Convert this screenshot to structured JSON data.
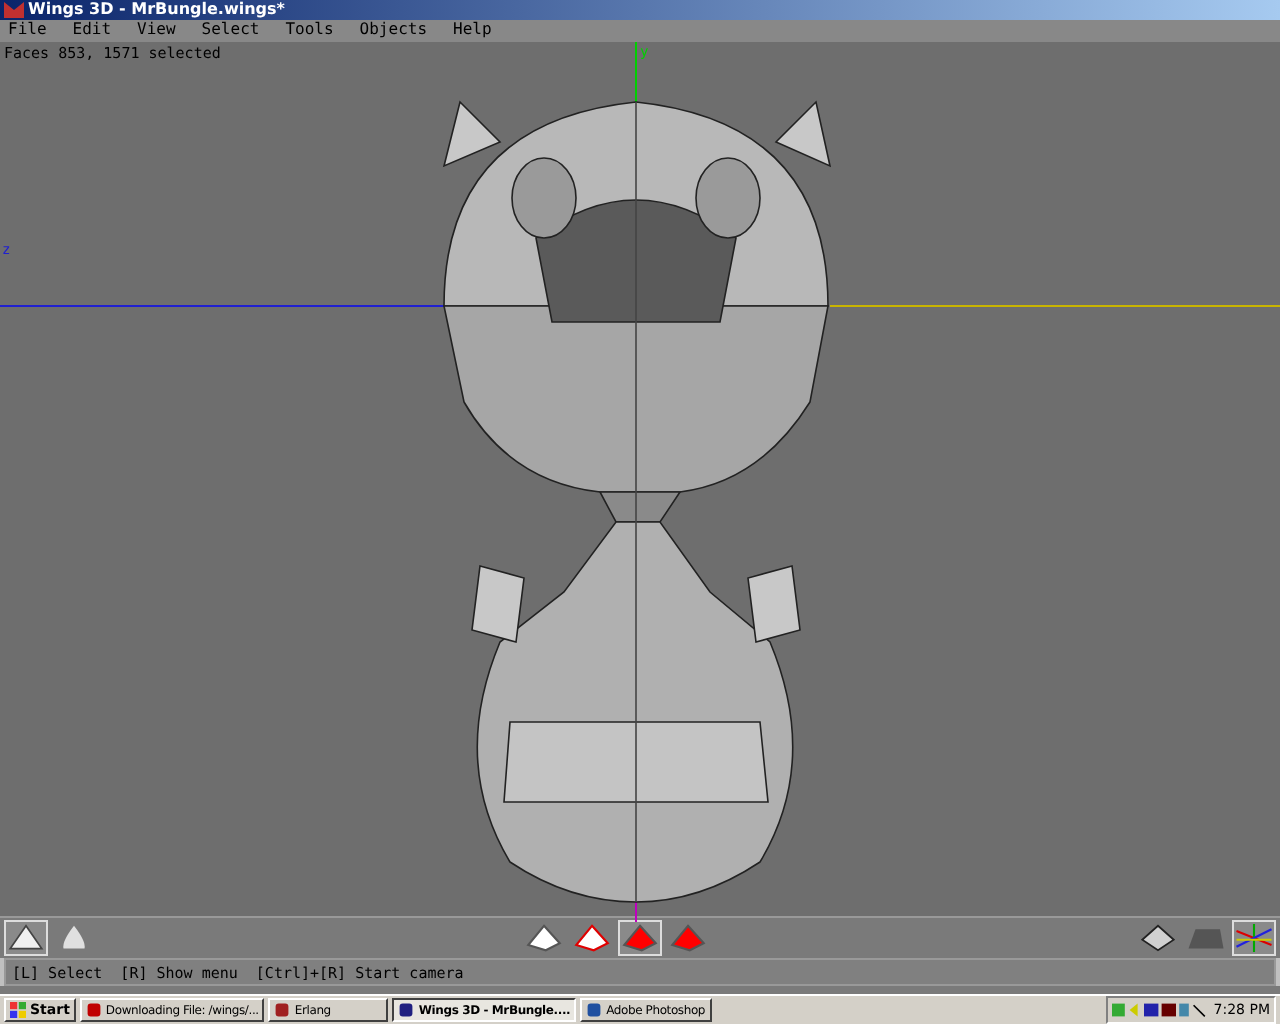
{
  "window": {
    "title": "Wings 3D - MrBungle.wings*"
  },
  "menu": [
    "File",
    "Edit",
    "View",
    "Select",
    "Tools",
    "Objects",
    "Help"
  ],
  "viewport": {
    "info": "Faces 853, 1571 selected",
    "axis_labels": [
      {
        "label": "z",
        "kind": "z"
      },
      {
        "label": "y",
        "kind": "y"
      }
    ]
  },
  "toolbar": {
    "views": [
      {
        "kind": "flat",
        "selected": true
      },
      {
        "kind": "smooth",
        "selected": false
      }
    ],
    "select_modes": [
      {
        "kind": "vertex",
        "selected": false
      },
      {
        "kind": "edge",
        "selected": false
      },
      {
        "kind": "face",
        "selected": true
      },
      {
        "kind": "body",
        "selected": false
      }
    ],
    "display": [
      {
        "kind": "perspective",
        "selected": false
      },
      {
        "kind": "ground",
        "selected": false
      },
      {
        "kind": "axes",
        "selected": true
      }
    ]
  },
  "status_bar": "[L] Select  [R] Show menu  [Ctrl]+[R] Start camera",
  "taskbar": {
    "start": "Start",
    "tasks": [
      {
        "label": "Downloading File: /wings/...",
        "kind": "browser",
        "selected": false
      },
      {
        "label": "Erlang",
        "kind": "erlang",
        "selected": false
      },
      {
        "label": "Wings 3D - MrBungle....",
        "kind": "wings",
        "selected": true
      },
      {
        "label": "Adobe Photoshop",
        "kind": "photoshop",
        "selected": false
      }
    ],
    "clock": "7:28 PM"
  }
}
